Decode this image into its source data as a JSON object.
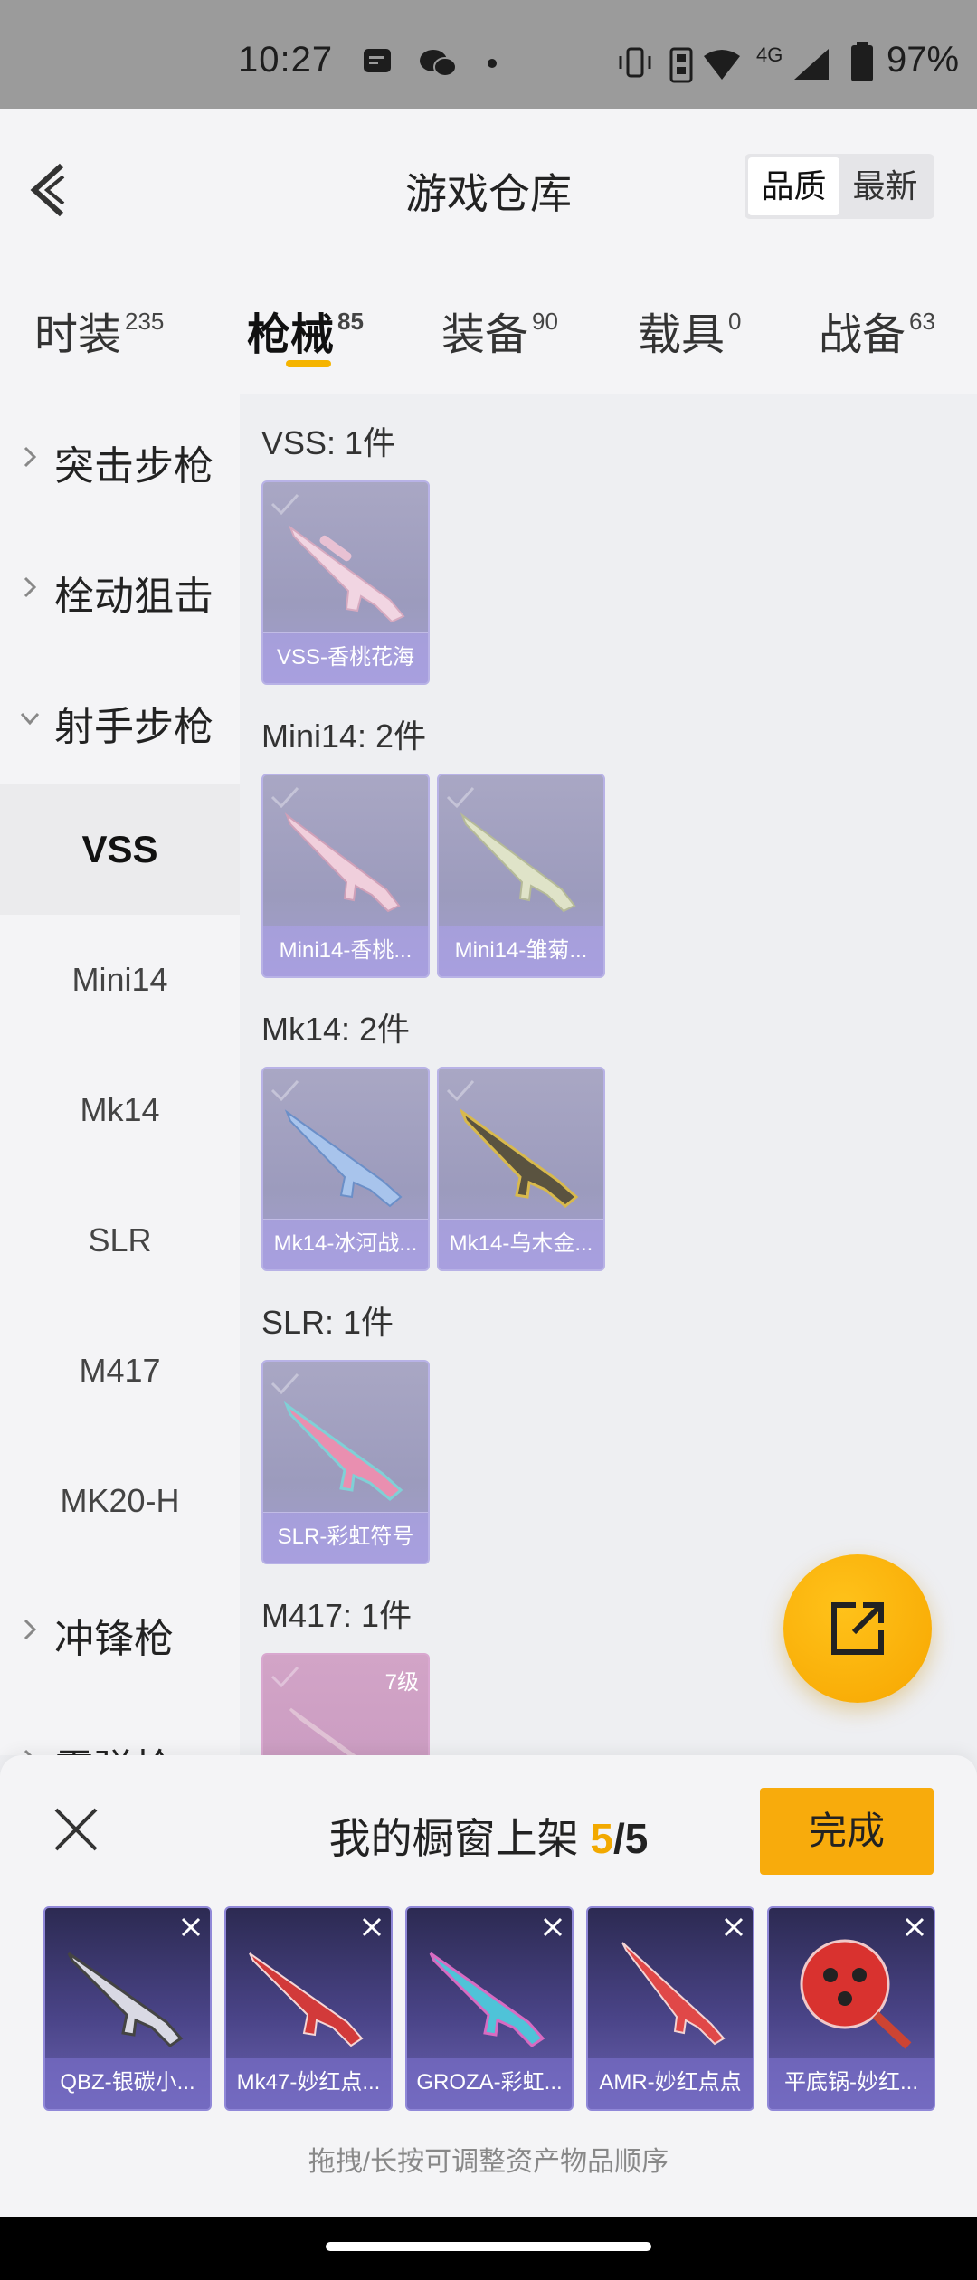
{
  "status_bar": {
    "time": "10:27",
    "network": "4G",
    "battery": "97%"
  },
  "header": {
    "title": "游戏仓库",
    "sort_options": [
      "品质",
      "最新"
    ],
    "selected_sort": "品质"
  },
  "tabs": [
    {
      "label": "时装",
      "count": "235"
    },
    {
      "label": "枪械",
      "count": "85"
    },
    {
      "label": "装备",
      "count": "90"
    },
    {
      "label": "载具",
      "count": "0"
    },
    {
      "label": "战备",
      "count": "63"
    }
  ],
  "active_tab": "枪械",
  "sidebar": {
    "categories": [
      "突击步枪",
      "栓动狙击",
      "射手步枪",
      "冲锋枪",
      "霰弹枪"
    ],
    "subitems": [
      "VSS",
      "Mini14",
      "Mk14",
      "SLR",
      "M417",
      "MK20-H"
    ],
    "active_subitem": "VSS"
  },
  "groups": [
    {
      "title": "VSS: 1件",
      "items": [
        {
          "name": "VSS-香桃花海"
        }
      ]
    },
    {
      "title": "Mini14: 2件",
      "items": [
        {
          "name": "Mini14-香桃..."
        },
        {
          "name": "Mini14-雏菊..."
        }
      ]
    },
    {
      "title": "Mk14: 2件",
      "items": [
        {
          "name": "Mk14-冰河战..."
        },
        {
          "name": "Mk14-乌木金..."
        }
      ]
    },
    {
      "title": "SLR: 1件",
      "items": [
        {
          "name": "SLR-彩虹符号"
        }
      ]
    },
    {
      "title": "M417: 1件",
      "items": [
        {
          "level": "7级"
        }
      ]
    }
  ],
  "showcase": {
    "title": "我的橱窗上架",
    "count": "5",
    "total": "/5",
    "done_label": "完成",
    "items": [
      "QBZ-银碳小...",
      "Mk47-妙红点...",
      "GROZA-彩虹...",
      "AMR-妙红点点",
      "平底锅-妙红..."
    ],
    "hint": "拖拽/长按可调整资产物品顺序"
  },
  "colors": {
    "accent": "#f8ab0c",
    "card": "#9c9bbd",
    "showcase_card": "#4a4488"
  }
}
